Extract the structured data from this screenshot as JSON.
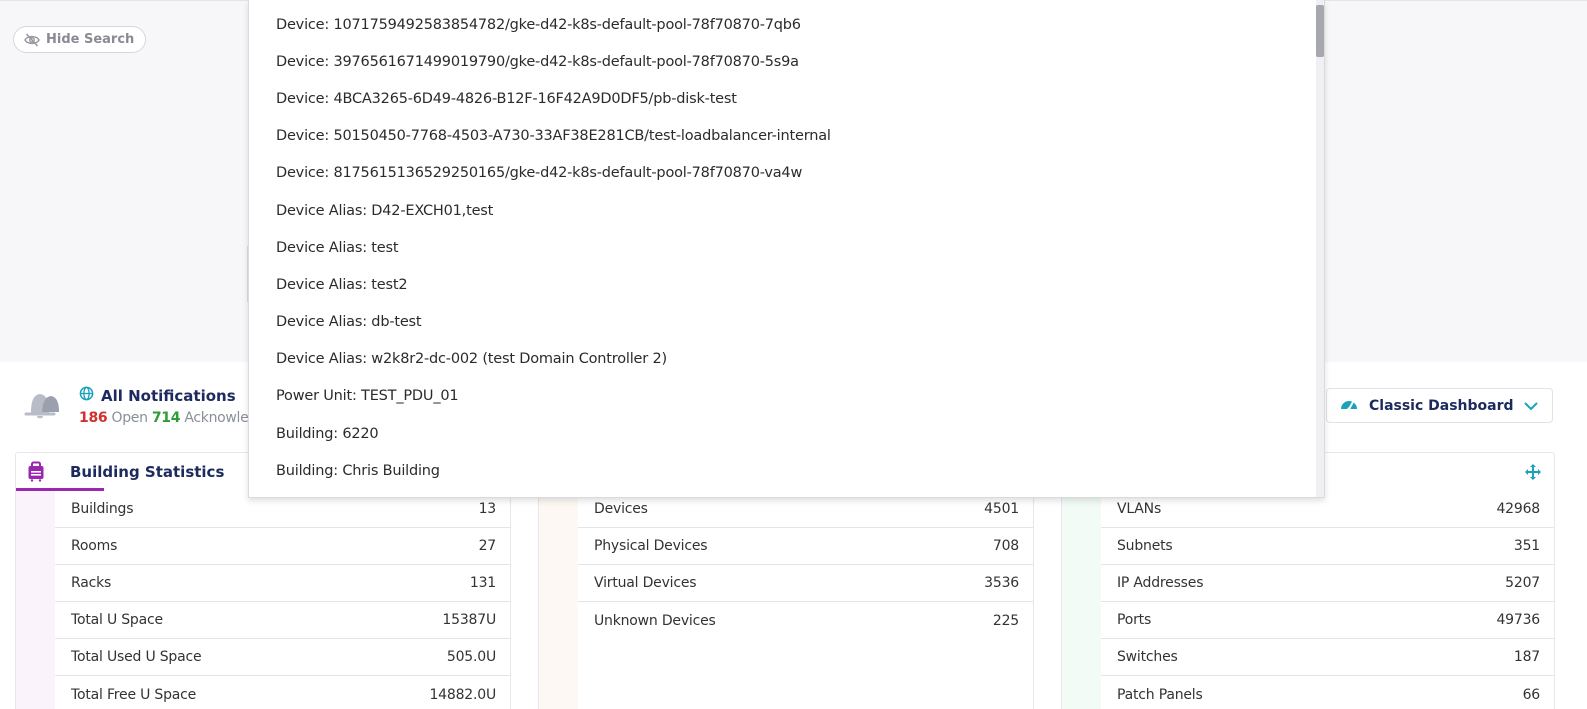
{
  "search": {
    "hide_label": "Hide Search"
  },
  "notifications": {
    "title": "All Notifications",
    "open_count": "186",
    "open_label": "Open",
    "ack_count": "714",
    "ack_label": "Acknowledg"
  },
  "dashboard_select": {
    "label": "Classic Dashboard"
  },
  "dropdown": {
    "items": [
      "Device: 1071759492583854782/gke-d42-k8s-default-pool-78f70870-7qb6",
      "Device: 3976561671499019790/gke-d42-k8s-default-pool-78f70870-5s9a",
      "Device: 4BCA3265-6D49-4826-B12F-16F42A9D0DF5/pb-disk-test",
      "Device: 50150450-7768-4503-A730-33AF38E281CB/test-loadbalancer-internal",
      "Device: 8175615136529250165/gke-d42-k8s-default-pool-78f70870-va4w",
      "Device Alias: D42-EXCH01,test",
      "Device Alias: test",
      "Device Alias: test2",
      "Device Alias: db-test",
      "Device Alias: w2k8r2-dc-002 (test Domain Controller 2)",
      "Power Unit: TEST_PDU_01",
      "Building: 6220",
      "Building: Chris Building"
    ]
  },
  "cards": {
    "building": {
      "title": "Building Statistics",
      "rows": [
        {
          "label": "Buildings",
          "value": "13"
        },
        {
          "label": "Rooms",
          "value": "27"
        },
        {
          "label": "Racks",
          "value": "131"
        },
        {
          "label": "Total U Space",
          "value": "15387U"
        },
        {
          "label": "Total Used U Space",
          "value": "505.0U"
        },
        {
          "label": "Total Free U Space",
          "value": "14882.0U"
        }
      ]
    },
    "devices": {
      "rows": [
        {
          "label": "Devices",
          "value": "4501"
        },
        {
          "label": "Physical Devices",
          "value": "708"
        },
        {
          "label": "Virtual Devices",
          "value": "3536"
        },
        {
          "label": "Unknown Devices",
          "value": "225"
        }
      ]
    },
    "network": {
      "rows": [
        {
          "label": "VLANs",
          "value": "42968"
        },
        {
          "label": "Subnets",
          "value": "351"
        },
        {
          "label": "IP Addresses",
          "value": "5207"
        },
        {
          "label": "Ports",
          "value": "49736"
        },
        {
          "label": "Switches",
          "value": "187"
        },
        {
          "label": "Patch Panels",
          "value": "66"
        }
      ]
    }
  },
  "colors": {
    "accent_purple": "#9b27b0",
    "title_navy": "#1c2a5e",
    "open_red": "#d32f2f",
    "ack_green": "#2e9e34",
    "dashboard_icon_teal": "#1aa3b8"
  },
  "icons": [
    "eye-slash-icon",
    "bell-icon",
    "globe-icon",
    "speedometer-icon",
    "chevron-down-icon",
    "suitcase-icon",
    "move-icon"
  ]
}
